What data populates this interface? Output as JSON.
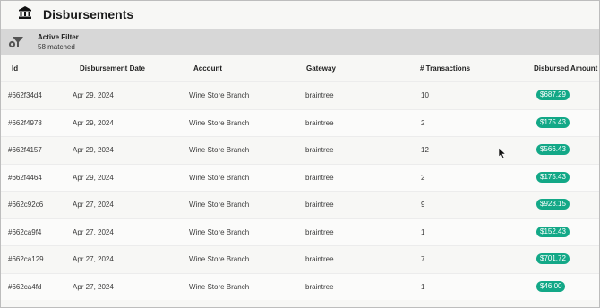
{
  "header": {
    "title": "Disbursements",
    "icon": "bank-icon"
  },
  "filter": {
    "title": "Active Filter",
    "count_text": "58 matched",
    "icon": "filter-icon"
  },
  "table": {
    "columns": {
      "id": "Id",
      "date": "Disbursement Date",
      "account": "Account",
      "gateway": "Gateway",
      "transactions": "# Transactions",
      "amount": "Disbursed Amount"
    },
    "rows": [
      {
        "id": "#662f34d4",
        "date": "Apr 29, 2024",
        "account": "Wine Store Branch",
        "gateway": "braintree",
        "transactions": "10",
        "amount": "$687.29"
      },
      {
        "id": "#662f4978",
        "date": "Apr 29, 2024",
        "account": "Wine Store Branch",
        "gateway": "braintree",
        "transactions": "2",
        "amount": "$175.43"
      },
      {
        "id": "#662f4157",
        "date": "Apr 29, 2024",
        "account": "Wine Store Branch",
        "gateway": "braintree",
        "transactions": "12",
        "amount": "$566.43"
      },
      {
        "id": "#662f4464",
        "date": "Apr 29, 2024",
        "account": "Wine Store Branch",
        "gateway": "braintree",
        "transactions": "2",
        "amount": "$175.43"
      },
      {
        "id": "#662c92c6",
        "date": "Apr 27, 2024",
        "account": "Wine Store Branch",
        "gateway": "braintree",
        "transactions": "9",
        "amount": "$923.15"
      },
      {
        "id": "#662ca9f4",
        "date": "Apr 27, 2024",
        "account": "Wine Store Branch",
        "gateway": "braintree",
        "transactions": "1",
        "amount": "$152.43"
      },
      {
        "id": "#662ca129",
        "date": "Apr 27, 2024",
        "account": "Wine Store Branch",
        "gateway": "braintree",
        "transactions": "7",
        "amount": "$701.72"
      },
      {
        "id": "#662ca4fd",
        "date": "Apr 27, 2024",
        "account": "Wine Store Branch",
        "gateway": "braintree",
        "transactions": "1",
        "amount": "$46.00"
      }
    ]
  },
  "colors": {
    "badge": "#13a887",
    "filter_bar": "#d7d7d7",
    "background": "#f7f7f5"
  }
}
